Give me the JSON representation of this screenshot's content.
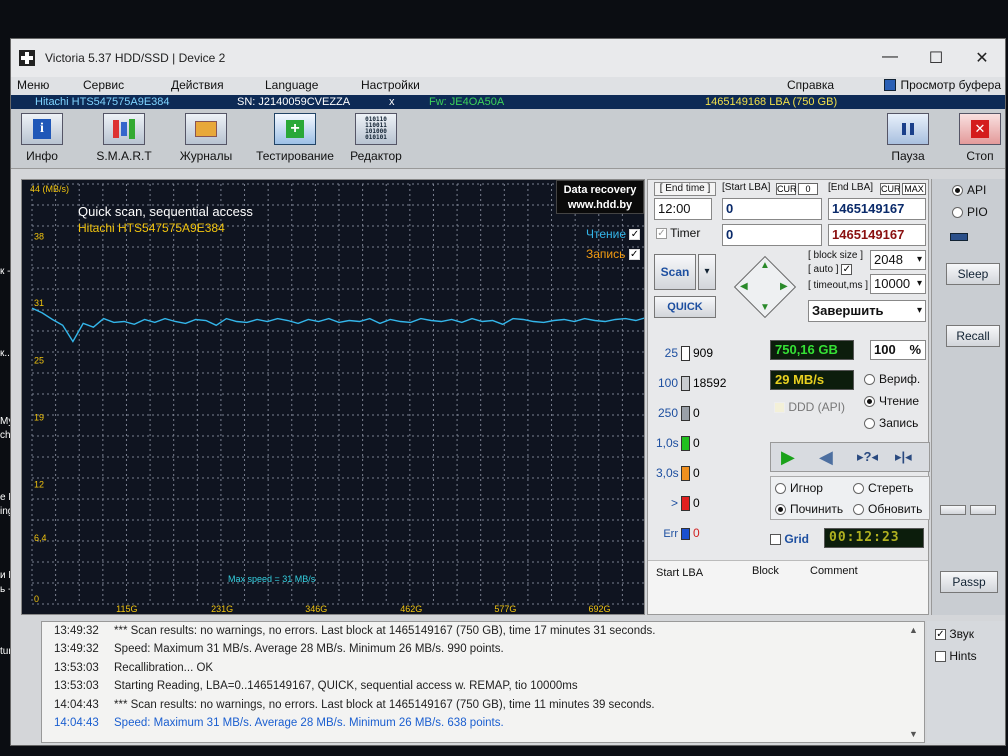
{
  "window": {
    "title": "Victoria 5.37 HDD/SSD | Device 2",
    "controls": [
      "—",
      "☐",
      "✕"
    ]
  },
  "menu": {
    "items": [
      "Меню",
      "Сервис",
      "Действия",
      "Language",
      "Настройки",
      "Справка"
    ],
    "buffer": "Просмотр буфера"
  },
  "device": {
    "model": "Hitachi HTS547575A9E384",
    "sn": "SN: J2140059CVEZZA",
    "x": "x",
    "fw": "Fw: JE4OA50A",
    "lba": "1465149168 LBA (750 GB)"
  },
  "toolbar": {
    "info": "Инфо",
    "smart": "S.M.A.R.T",
    "journals": "Журналы",
    "testing": "Тестирование",
    "editor": "Редактор",
    "pause": "Пауза",
    "stop": "Стоп"
  },
  "graph": {
    "unit_label": "44 (MB/s)",
    "y_ticks": [
      "38",
      "31",
      "25",
      "19",
      "12",
      "6,4",
      "0"
    ],
    "x_ticks": [
      "115G",
      "231G",
      "346G",
      "462G",
      "577G",
      "692G"
    ],
    "title": "Quick scan, sequential access",
    "model": "Hitachi HTS547575A9E384",
    "read_label": "Чтение",
    "write_label": "Запись",
    "max_speed": "Max speed = 31 MB/s",
    "data_recovery": "Data recovery",
    "site": "www.hdd.by",
    "series": {
      "y_max": 44,
      "x_max": 750,
      "values": [
        31,
        30.5,
        29.8,
        29.2,
        27.5,
        29.4,
        29.0,
        29.9,
        29.5,
        29.6,
        29.3,
        29.8,
        29.5,
        29.9,
        29.6,
        29.4,
        29.8,
        29.7,
        29.2,
        29.9,
        29.6,
        29.5,
        29.8,
        29.6,
        29.9,
        29.7,
        29.4,
        29.8,
        29.6,
        29.9,
        29.5,
        29.7,
        29.6,
        29.9,
        29.4,
        29.8,
        29.6,
        29.5,
        29.9,
        29.7,
        29.6,
        29.8,
        29.5,
        29.9,
        29.6,
        29.7,
        29.3,
        29.9,
        29.8,
        29.6,
        29.5,
        29.7,
        29.8,
        29.6,
        29.9,
        29.7,
        29.6,
        29.8,
        29.9,
        29.7,
        30.0
      ]
    }
  },
  "controls": {
    "end_time": "[ End time ]",
    "start_lba": "[Start LBA]",
    "cur": "CUR",
    "zero": "0",
    "end_lba": "[End LBA]",
    "max": "MAX",
    "time_value": "12:00",
    "start_value": "0",
    "end_value": "1465149167",
    "timer": "Timer",
    "timer_value": "0",
    "cur_lba_value": "1465149167",
    "block_size": "[ block size ]",
    "auto": "[ auto ]",
    "block_value": "2048",
    "timeout": "[ timeout,ms ]",
    "timeout_value": "10000",
    "scan": "Scan",
    "quick": "QUICK",
    "finish": "Завершить"
  },
  "blocks": [
    {
      "label": "25",
      "count": "909",
      "color": "#ffffff"
    },
    {
      "label": "100",
      "count": "18592",
      "color": "#c9ccd0"
    },
    {
      "label": "250",
      "count": "0",
      "color": "#9aa0a8"
    },
    {
      "label": "1,0s",
      "count": "0",
      "color": "#22c020"
    },
    {
      "label": "3,0s",
      "count": "0",
      "color": "#f09020"
    },
    {
      "label": ">",
      "count": "0",
      "color": "#e02020"
    },
    {
      "label": "Err",
      "count": "0",
      "color": "#1a50d0"
    }
  ],
  "stats": {
    "size": "750,16 GB",
    "percent": "100",
    "percent_sign": "%",
    "speed": "29 MB/s",
    "ddd": "DDD (API)",
    "verify": "Вериф.",
    "read": "Чтение",
    "write": "Запись",
    "ignore": "Игнор",
    "erase": "Стереть",
    "repair": "Починить",
    "refresh": "Обновить",
    "grid": "Grid",
    "timer_display": "00:12:23"
  },
  "table_headers": [
    "Start LBA",
    "Block",
    "Comment"
  ],
  "side": {
    "api": "API",
    "pio": "PIO",
    "sleep": "Sleep",
    "recall": "Recall",
    "passp": "Passp",
    "sound": "Звук",
    "hints": "Hints"
  },
  "log": [
    {
      "time": "13:49:32",
      "text": "*** Scan results: no warnings, no errors. Last block at 1465149167 (750 GB), time 17 minutes 31 seconds.",
      "blue": false
    },
    {
      "time": "13:49:32",
      "text": "Speed: Maximum 31 MB/s. Average 28 MB/s. Minimum 26 MB/s. 990 points.",
      "blue": false
    },
    {
      "time": "13:53:03",
      "text": "Recallibration... OK",
      "blue": false
    },
    {
      "time": "13:53:03",
      "text": "Starting Reading, LBA=0..1465149167, QUICK, sequential access w. REMAP, tio 10000ms",
      "blue": false
    },
    {
      "time": "14:04:43",
      "text": "*** Scan results: no warnings, no errors. Last block at 1465149167 (750 GB), time 11 minutes 39 seconds.",
      "blue": false
    },
    {
      "time": "14:04:43",
      "text": "Speed: Maximum 31 MB/s. Average 28 MB/s. Minimum 26 MB/s. 638 points.",
      "blue": true
    }
  ],
  "desktop": [
    "к -",
    "к...",
    "My",
    "ch",
    "e My",
    "ing .",
    "и Не",
    "ь - Ti.",
    "tures"
  ],
  "colors": {
    "graph_line": "#34b6ea",
    "grid": "#7a8090",
    "lcd_green": "#35e035",
    "title_blue": "#0d2a55"
  }
}
